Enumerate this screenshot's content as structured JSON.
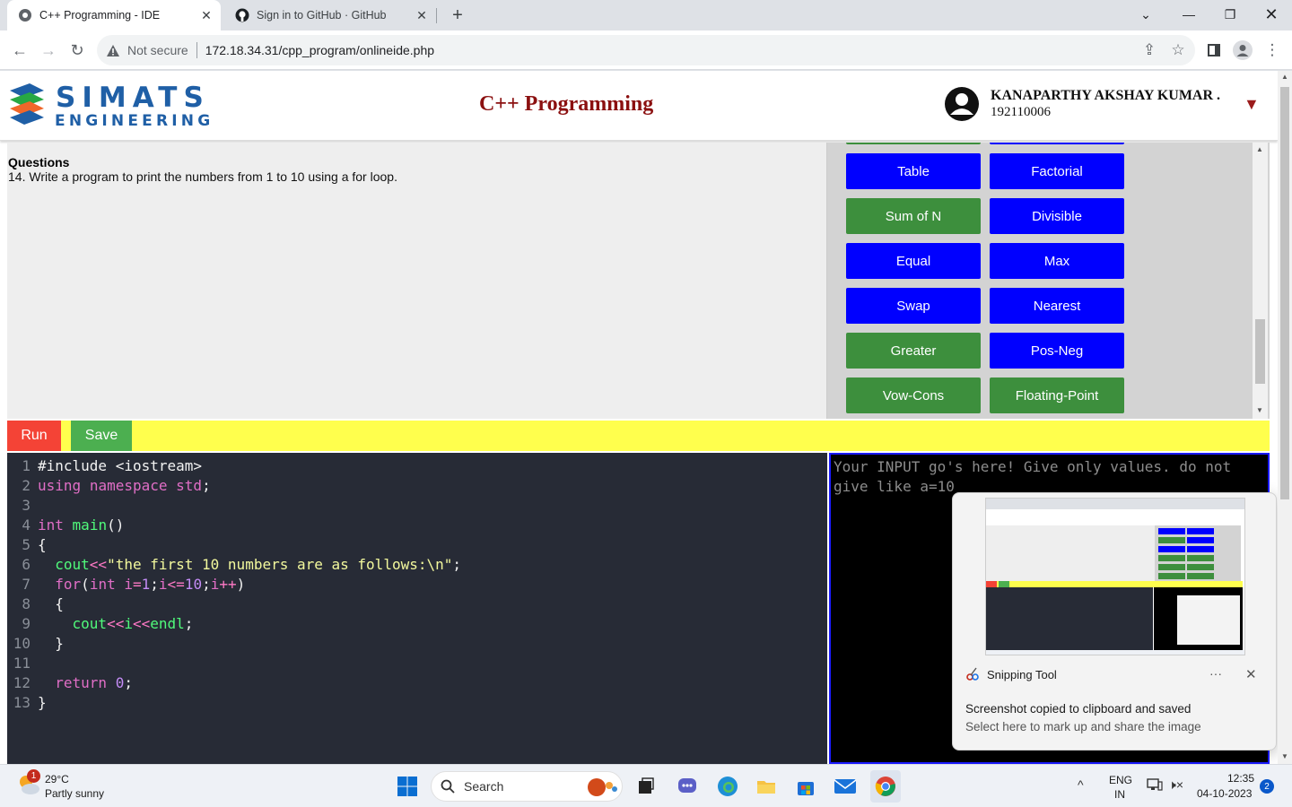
{
  "browser": {
    "tabs": [
      {
        "title": "C++ Programming - IDE",
        "active": true
      },
      {
        "title": "Sign in to GitHub · GitHub",
        "active": false
      }
    ],
    "security_label": "Not secure",
    "url": "172.18.34.31/cpp_program/onlineide.php"
  },
  "header": {
    "logo_top": "SIMATS",
    "logo_bottom": "ENGINEERING",
    "title": "C++ Programming",
    "user_name": "KANAPARTHY AKSHAY KUMAR .",
    "user_id": "192110006"
  },
  "question": {
    "heading": "Questions",
    "text": "14. Write a program to print the numbers from 1 to 10 using a for loop."
  },
  "question_buttons": [
    {
      "label": "Table",
      "color": "#0000ff"
    },
    {
      "label": "Factorial",
      "color": "#0000ff"
    },
    {
      "label": "Sum of N",
      "color": "#3d8f3d"
    },
    {
      "label": "Divisible",
      "color": "#0000ff"
    },
    {
      "label": "Equal",
      "color": "#0000ff"
    },
    {
      "label": "Max",
      "color": "#0000ff"
    },
    {
      "label": "Swap",
      "color": "#0000ff"
    },
    {
      "label": "Nearest",
      "color": "#0000ff"
    },
    {
      "label": "Greater",
      "color": "#3d8f3d"
    },
    {
      "label": "Pos-Neg",
      "color": "#0000ff"
    },
    {
      "label": "Vow-Cons",
      "color": "#3d8f3d"
    },
    {
      "label": "Floating-Point",
      "color": "#3d8f3d"
    }
  ],
  "actions": {
    "run": "Run",
    "save": "Save"
  },
  "editor": {
    "lines": [
      {
        "n": "1",
        "tokens": [
          {
            "t": "#include <iostream>",
            "c": "prep"
          }
        ]
      },
      {
        "n": "2",
        "tokens": [
          {
            "t": "using",
            "c": "kw"
          },
          {
            "t": " ",
            "c": "pl"
          },
          {
            "t": "namespace",
            "c": "kw"
          },
          {
            "t": " ",
            "c": "pl"
          },
          {
            "t": "std",
            "c": "kw"
          },
          {
            "t": ";",
            "c": "pl"
          }
        ]
      },
      {
        "n": "3",
        "tokens": []
      },
      {
        "n": "4",
        "tokens": [
          {
            "t": "int",
            "c": "kw"
          },
          {
            "t": " ",
            "c": "pl"
          },
          {
            "t": "main",
            "c": "fn"
          },
          {
            "t": "()",
            "c": "pl"
          }
        ]
      },
      {
        "n": "5",
        "tokens": [
          {
            "t": "{",
            "c": "pl"
          }
        ]
      },
      {
        "n": "6",
        "tokens": [
          {
            "t": "  cout",
            "c": "fn"
          },
          {
            "t": "<<",
            "c": "op"
          },
          {
            "t": "\"the first 10 numbers are as follows:\\n\"",
            "c": "str"
          },
          {
            "t": ";",
            "c": "pl"
          }
        ]
      },
      {
        "n": "7",
        "tokens": [
          {
            "t": "  for",
            "c": "kw"
          },
          {
            "t": "(",
            "c": "pl"
          },
          {
            "t": "int",
            "c": "kw"
          },
          {
            "t": " i",
            "c": "kw"
          },
          {
            "t": "=",
            "c": "op"
          },
          {
            "t": "1",
            "c": "num"
          },
          {
            "t": ";",
            "c": "pl"
          },
          {
            "t": "i",
            "c": "kw"
          },
          {
            "t": "<=",
            "c": "op"
          },
          {
            "t": "10",
            "c": "num"
          },
          {
            "t": ";",
            "c": "pl"
          },
          {
            "t": "i",
            "c": "kw"
          },
          {
            "t": "++",
            "c": "op"
          },
          {
            "t": ")",
            "c": "pl"
          }
        ]
      },
      {
        "n": "8",
        "tokens": [
          {
            "t": "  {",
            "c": "pl"
          }
        ]
      },
      {
        "n": "9",
        "tokens": [
          {
            "t": "    cout",
            "c": "fn"
          },
          {
            "t": "<<",
            "c": "op"
          },
          {
            "t": "i",
            "c": "fn"
          },
          {
            "t": "<<",
            "c": "op"
          },
          {
            "t": "endl",
            "c": "fn"
          },
          {
            "t": ";",
            "c": "pl"
          }
        ]
      },
      {
        "n": "10",
        "tokens": [
          {
            "t": "  }",
            "c": "pl"
          }
        ]
      },
      {
        "n": "11",
        "tokens": []
      },
      {
        "n": "12",
        "tokens": [
          {
            "t": "  return",
            "c": "kw"
          },
          {
            "t": " ",
            "c": "pl"
          },
          {
            "t": "0",
            "c": "num"
          },
          {
            "t": ";",
            "c": "pl"
          }
        ]
      },
      {
        "n": "13",
        "tokens": [
          {
            "t": "}",
            "c": "pl"
          }
        ]
      }
    ]
  },
  "input_area": {
    "placeholder": "Your INPUT go's here! Give only values. do not give like a=10"
  },
  "notification": {
    "app": "Snipping Tool",
    "title": "Screenshot copied to clipboard and saved",
    "subtitle": "Select here to mark up and share the image"
  },
  "taskbar": {
    "weather_temp": "29°C",
    "weather_desc": "Partly sunny",
    "weather_badge": "1",
    "search_label": "Search",
    "lang_1": "ENG",
    "lang_2": "IN",
    "time": "12:35",
    "date": "04-10-2023",
    "notif_count": "2"
  }
}
